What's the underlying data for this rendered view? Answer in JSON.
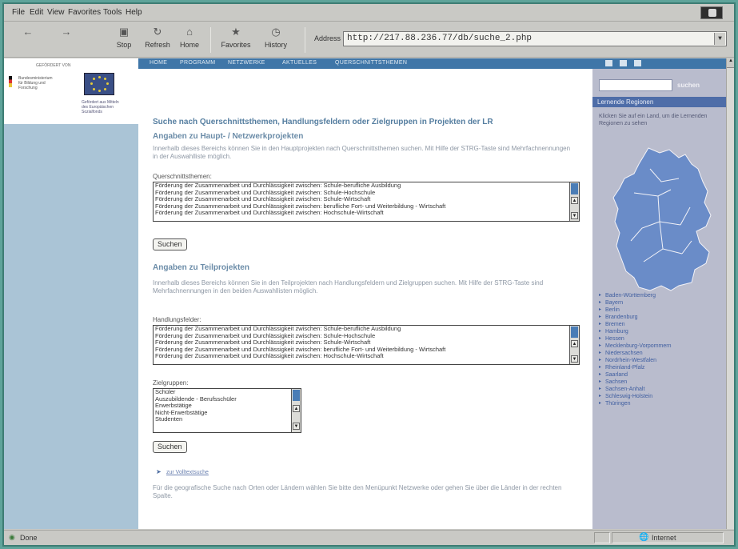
{
  "menu": [
    "File",
    "Edit",
    "View",
    "Favorites",
    "Tools",
    "Help"
  ],
  "toolbar": {
    "buttons": [
      {
        "label": "",
        "icon": "back-arrow-icon"
      },
      {
        "label": "",
        "icon": "forward-arrow-icon"
      },
      {
        "label": "Stop",
        "icon": "stop-icon"
      },
      {
        "label": "Refresh",
        "icon": "refresh-icon"
      },
      {
        "label": "Home",
        "icon": "home-icon"
      },
      {
        "label": "Favorites",
        "icon": "favorites-icon"
      },
      {
        "label": "History",
        "icon": "history-icon"
      }
    ],
    "address_label": "Address",
    "address_value": "http://217.88.236.77/db/suche_2.php"
  },
  "logos": {
    "top": "GEFÖRDERT VON",
    "bmbf": "Bundesministerium für Bildung und Forschung",
    "eu": "Gefördert aus Mitteln des Europäischen Sozialfonds"
  },
  "nav": [
    "HOME",
    "PROGRAMM",
    "NETZWERKE",
    "AKTUELLES",
    "QUERSCHNITTSTHEMEN"
  ],
  "sidebar": {
    "search_button": "suchen",
    "map_title": "Lernende Regionen",
    "map_hint": "Klicken Sie auf ein Land, um die Lernenden Regionen zu sehen",
    "states": [
      "Baden-Württemberg",
      "Bayern",
      "Berlin",
      "Brandenburg",
      "Bremen",
      "Hamburg",
      "Hessen",
      "Mecklenburg-Vorpommern",
      "Niedersachsen",
      "Nordrhein-Westfalen",
      "Rheinland-Pfalz",
      "Saarland",
      "Sachsen",
      "Sachsen-Anhalt",
      "Schleswig-Holstein",
      "Thüringen"
    ]
  },
  "main": {
    "title": "Suche nach Querschnittsthemen, Handlungsfeldern oder Zielgruppen in Projekten der LR",
    "section1_heading": "Angaben zu Haupt- / Netzwerkprojekten",
    "section1_desc": "Innerhalb dieses Bereichs können Sie in den Hauptprojekten nach Querschnittsthemen suchen. Mit Hilfe der STRG-Taste sind Mehrfachnennungen in der Auswahlliste möglich.",
    "list1_label": "Querschnittsthemen:",
    "list1_items": [
      "Förderung der Zusammenarbeit und Durchlässigkeit zwischen: Schule-berufliche Ausbildung",
      "Förderung der Zusammenarbeit und Durchlässigkeit zwischen: Schule-Hochschule",
      "Förderung der Zusammenarbeit und Durchlässigkeit zwischen: Schule-Wirtschaft",
      "Förderung der Zusammenarbeit und Durchlässigkeit zwischen: berufliche Fort- und Weiterbildung - Wirtschaft",
      "Förderung der Zusammenarbeit und Durchlässigkeit zwischen: Hochschule-Wirtschaft"
    ],
    "button1": "Suchen",
    "section2_heading": "Angaben zu Teilprojekten",
    "section2_desc": "Innerhalb dieses Bereichs können Sie in den Teilprojekten nach Handlungsfeldern und Zielgruppen suchen. Mit Hilfe der STRG-Taste sind Mehrfachnennungen in den beiden Auswahllisten möglich.",
    "list2_label": "Handlungsfelder:",
    "list2_items": [
      "Förderung der Zusammenarbeit und Durchlässigkeit zwischen: Schule-berufliche Ausbildung",
      "Förderung der Zusammenarbeit und Durchlässigkeit zwischen: Schule-Hochschule",
      "Förderung der Zusammenarbeit und Durchlässigkeit zwischen: Schule-Wirtschaft",
      "Förderung der Zusammenarbeit und Durchlässigkeit zwischen: berufliche Fort- und Weiterbildung - Wirtschaft",
      "Förderung der Zusammenarbeit und Durchlässigkeit zwischen: Hochschule-Wirtschaft"
    ],
    "list3_label": "Zielgruppen:",
    "list3_items": [
      "Schüler",
      "Auszubildende - Berufsschüler",
      "Erwerbstätige",
      "Nicht-Erwerbstätige",
      "Studenten"
    ],
    "button2": "Suchen",
    "link": "zur Volltextsuche",
    "footer_text": "Für die geografische Suche nach Orten oder Ländern wählen Sie bitte den Menüpunkt Netzwerke oder gehen Sie über die Länder in der rechten Spalte."
  },
  "status": {
    "left": "Done",
    "right": "Internet"
  }
}
